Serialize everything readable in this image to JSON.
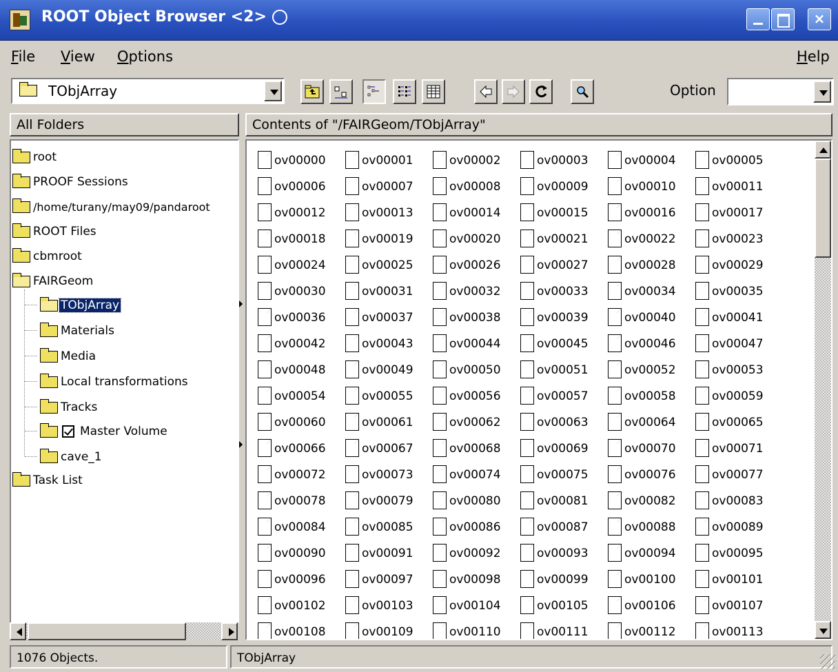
{
  "window": {
    "title": "ROOT Object Browser <2>"
  },
  "menu": {
    "file": "File",
    "view": "View",
    "options": "Options",
    "help": "Help"
  },
  "toolbar": {
    "path": "TObjArray",
    "option_label": "Option",
    "option_value": ""
  },
  "left_header": "All Folders",
  "right_header": "Contents of \"/FAIRGeom/TObjArray\"",
  "tree": [
    {
      "label": "root"
    },
    {
      "label": "PROOF Sessions"
    },
    {
      "label": "/home/turany/may09/pandaroot"
    },
    {
      "label": "ROOT Files"
    },
    {
      "label": "cbmroot"
    },
    {
      "label": "FAIRGeom"
    },
    {
      "label": "TObjArray"
    },
    {
      "label": "Materials"
    },
    {
      "label": "Media"
    },
    {
      "label": "Local transformations"
    },
    {
      "label": "Tracks"
    },
    {
      "label": "Master Volume"
    },
    {
      "label": "cave_1"
    },
    {
      "label": "Task List"
    }
  ],
  "items": [
    "ov00000",
    "ov00001",
    "ov00002",
    "ov00003",
    "ov00004",
    "ov00005",
    "ov00006",
    "ov00007",
    "ov00008",
    "ov00009",
    "ov00010",
    "ov00011",
    "ov00012",
    "ov00013",
    "ov00014",
    "ov00015",
    "ov00016",
    "ov00017",
    "ov00018",
    "ov00019",
    "ov00020",
    "ov00021",
    "ov00022",
    "ov00023",
    "ov00024",
    "ov00025",
    "ov00026",
    "ov00027",
    "ov00028",
    "ov00029",
    "ov00030",
    "ov00031",
    "ov00032",
    "ov00033",
    "ov00034",
    "ov00035",
    "ov00036",
    "ov00037",
    "ov00038",
    "ov00039",
    "ov00040",
    "ov00041",
    "ov00042",
    "ov00043",
    "ov00044",
    "ov00045",
    "ov00046",
    "ov00047",
    "ov00048",
    "ov00049",
    "ov00050",
    "ov00051",
    "ov00052",
    "ov00053",
    "ov00054",
    "ov00055",
    "ov00056",
    "ov00057",
    "ov00058",
    "ov00059",
    "ov00060",
    "ov00061",
    "ov00062",
    "ov00063",
    "ov00064",
    "ov00065",
    "ov00066",
    "ov00067",
    "ov00068",
    "ov00069",
    "ov00070",
    "ov00071",
    "ov00072",
    "ov00073",
    "ov00074",
    "ov00075",
    "ov00076",
    "ov00077",
    "ov00078",
    "ov00079",
    "ov00080",
    "ov00081",
    "ov00082",
    "ov00083",
    "ov00084",
    "ov00085",
    "ov00086",
    "ov00087",
    "ov00088",
    "ov00089",
    "ov00090",
    "ov00091",
    "ov00092",
    "ov00093",
    "ov00094",
    "ov00095",
    "ov00096",
    "ov00097",
    "ov00098",
    "ov00099",
    "ov00100",
    "ov00101",
    "ov00102",
    "ov00103",
    "ov00104",
    "ov00105",
    "ov00106",
    "ov00107",
    "ov00108",
    "ov00109",
    "ov00110",
    "ov00111",
    "ov00112",
    "ov00113"
  ],
  "status": {
    "left": "1076 Objects.",
    "right": "TObjArray"
  }
}
